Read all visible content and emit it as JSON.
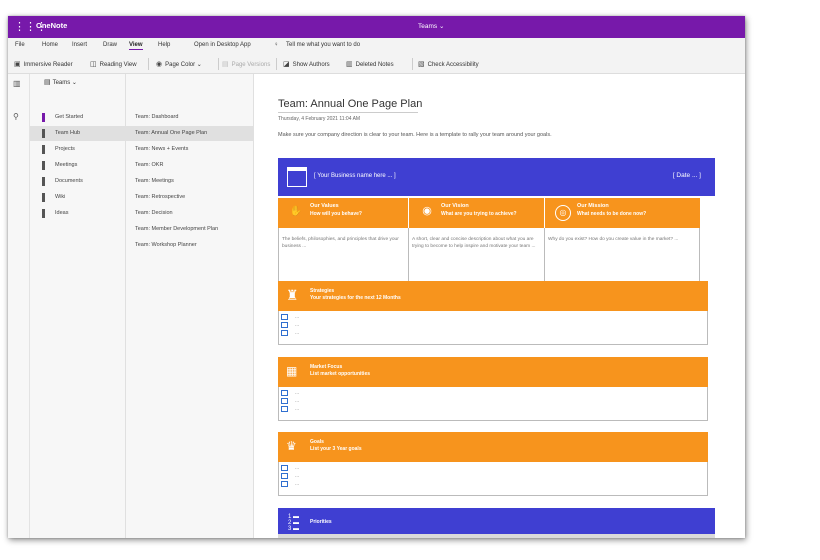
{
  "app": {
    "name": "OneNote",
    "center_title": "Teams ⌄",
    "accent": "#7719aa"
  },
  "menu": [
    "File",
    "Home",
    "Insert",
    "Draw",
    "View",
    "Help",
    "Open in Desktop App",
    "Tell me what you want to do"
  ],
  "menu_active": "View",
  "ribbon": {
    "immersive_reader": "Immersive Reader",
    "reading_view": "Reading View",
    "page_color": "Page Color ⌄",
    "page_versions": "Page Versions",
    "show_authors": "Show Authors",
    "deleted_notes": "Deleted Notes",
    "check_accessibility": "Check Accessibility"
  },
  "notebook": {
    "label": "Teams ⌄"
  },
  "sections": [
    {
      "label": "Get Started",
      "color": "#7719aa"
    },
    {
      "label": "Team Hub",
      "color": "#444444",
      "selected": true
    },
    {
      "label": "Projects",
      "color": "#444444"
    },
    {
      "label": "Meetings",
      "color": "#444444"
    },
    {
      "label": "Documents",
      "color": "#444444"
    },
    {
      "label": "Wiki",
      "color": "#444444"
    },
    {
      "label": "Ideas",
      "color": "#444444"
    }
  ],
  "pages": [
    {
      "label": "Team: Dashboard"
    },
    {
      "label": "Team: Annual One Page Plan",
      "selected": true
    },
    {
      "label": "Team: News + Events"
    },
    {
      "label": "Team: OKR"
    },
    {
      "label": "Team: Meetings"
    },
    {
      "label": "Team: Retrospective"
    },
    {
      "label": "Team: Decision"
    },
    {
      "label": "Team: Member Development Plan"
    },
    {
      "label": "Team: Workshop Planner"
    }
  ],
  "page": {
    "title": "Team: Annual One Page Plan",
    "date": "Thursday, 4 February 2021    11:04 AM",
    "intro": "Make sure your company direction is clear to your team. Here is a template to rally your team around your goals.",
    "business_name": "[ Your Business name here ... ]",
    "date_placeholder": "[ Date ... ]",
    "values": {
      "title": "Our Values",
      "subtitle": "How will you behave?",
      "body": "The beliefs, philosophies, and principles that drive your business ..."
    },
    "vision": {
      "title": "Our Vision",
      "subtitle": "What are you trying to achieve?",
      "body": "A short, clear and concise description about what you are trying to become to help inspire and motivate your team ..."
    },
    "mission": {
      "title": "Our Mission",
      "subtitle": "What needs to be done now?",
      "body": "Why do you exist? How do you create value in the market? ..."
    },
    "strategies": {
      "title": "Strategies",
      "subtitle": "Your strategies for the next 12 Months"
    },
    "market": {
      "title": "Market Focus",
      "subtitle": "List market opportunities"
    },
    "goals": {
      "title": "Goals",
      "subtitle": "List your 3 Year goals"
    },
    "priorities": {
      "title": "Priorities"
    },
    "list_item": "..."
  },
  "colors": {
    "orange": "#f7941d",
    "blue": "#3f3fd2"
  },
  "icons": [
    "waffle-icon",
    "immersive-reader-icon",
    "reading-view-icon",
    "page-color-icon",
    "page-versions-icon",
    "show-authors-icon",
    "deleted-notes-icon",
    "check-accessibility-icon",
    "lightbulb-icon",
    "notebooks-icon",
    "search-icon",
    "notebook-icon",
    "storefront-icon",
    "handshake-icon",
    "eye-icon",
    "target-icon",
    "chess-icon",
    "market-icon",
    "trophy-icon",
    "numbered-list-icon"
  ]
}
